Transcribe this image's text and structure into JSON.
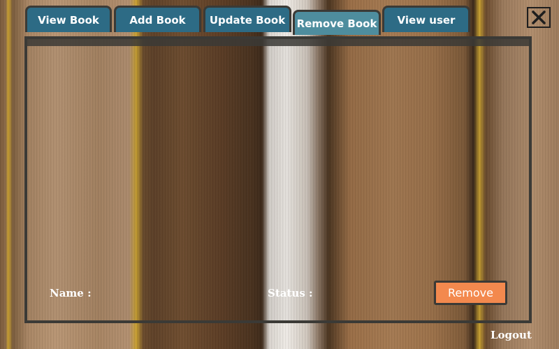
{
  "tabs": [
    {
      "label": "View Book"
    },
    {
      "label": "Add Book"
    },
    {
      "label": "Update Book"
    },
    {
      "label": "Remove Book",
      "active": true
    },
    {
      "label": "View user"
    }
  ],
  "form": {
    "name_label": "Name :",
    "status_label": "Status :",
    "remove_label": "Remove"
  },
  "footer": {
    "logout_label": "Logout"
  },
  "icons": {
    "close": "close-icon"
  },
  "colors": {
    "tab": "#2d6b85",
    "tab_active": "#4e8d9e",
    "remove_button": "#f3894e",
    "frame": "#3b3a36"
  }
}
